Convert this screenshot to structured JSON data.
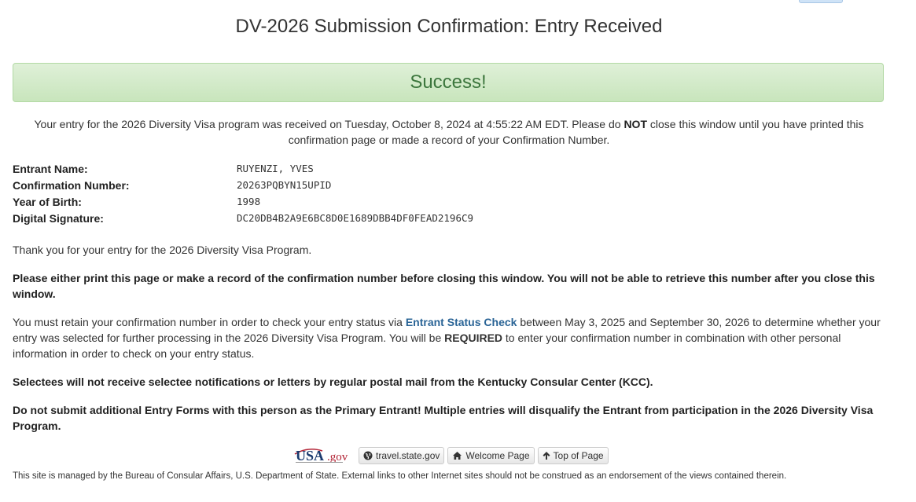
{
  "page_title": "DV-2026 Submission Confirmation: Entry Received",
  "alert": {
    "text": "Success!",
    "color": "#3c763d"
  },
  "received": {
    "part1": "Your entry for the 2026 Diversity Visa program was received on Tuesday, October 8, 2024 at 4:55:22 AM EDT. Please do ",
    "emph": "NOT",
    "part2": " close this window until you have printed this confirmation page or made a record of your Confirmation Number."
  },
  "entry": {
    "rows": [
      {
        "label": "Entrant Name:",
        "value": "RUYENZI, YVES"
      },
      {
        "label": "Confirmation Number:",
        "value": "20263PQBYN15UPID"
      },
      {
        "label": "Year of Birth:",
        "value": "1998"
      },
      {
        "label": "Digital Signature:",
        "value": "DC20DB4B2A9E6BC8D0E1689DBB4DF0FEAD2196C9"
      }
    ]
  },
  "thanks": "Thank you for your entry for the 2026 Diversity Visa Program.",
  "print_warning": "Please either print this page or make a record of the confirmation number before closing this window. You will not be able to retrieve this number after you close this window.",
  "retain": {
    "part1": "You must retain your confirmation number in order to check your entry status via ",
    "link": "Entrant Status Check",
    "part2": " between May 3, 2025 and September 30, 2026 to determine whether your entry was selected for further processing in the 2026 Diversity Visa Program. You will be ",
    "emph": "REQUIRED",
    "part3": " to enter your confirmation number in combination with other personal information in order to check on your entry status."
  },
  "selectees": "Selectees will not receive selectee notifications or letters by regular postal mail from the Kentucky Consular Center (KCC).",
  "multiple": "Do not submit additional Entry Forms with this person as the Primary Entrant! Multiple entries will disqualify the Entrant from participation in the 2026 Diversity Visa Program.",
  "footer": {
    "logo_text": "USA.gov",
    "logo_icon": "usa-gov-logo",
    "buttons": [
      {
        "label": "travel.state.gov",
        "icon": "globe-icon"
      },
      {
        "label": "Welcome Page",
        "icon": "home-icon"
      },
      {
        "label": "Top of Page",
        "icon": "arrow-up-icon"
      }
    ],
    "disclaimer": "This site is managed by the Bureau of Consular Affairs, U.S. Department of State. External links to other Internet sites should not be construed as an endorsement of the views contained therein."
  },
  "colors": {
    "link": "#2a6496",
    "success_bg": "#dff0d8",
    "success_border": "#b2d9a4"
  }
}
